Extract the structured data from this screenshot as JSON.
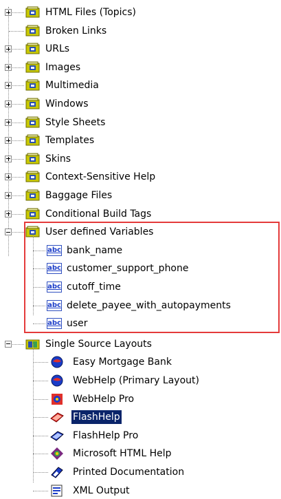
{
  "tree": {
    "folders": [
      {
        "label": "HTML Files (Topics)",
        "toggle": "plus",
        "icon": "folder-globe-icon",
        "color": "#c8c800"
      },
      {
        "label": "Broken Links",
        "toggle": "none",
        "icon": "folder-broken-links-icon",
        "color": "#c8c800"
      },
      {
        "label": "URLs",
        "toggle": "plus",
        "icon": "folder-url-icon",
        "color": "#c8c800"
      },
      {
        "label": "Images",
        "toggle": "plus",
        "icon": "folder-images-icon",
        "color": "#c8c800"
      },
      {
        "label": "Multimedia",
        "toggle": "plus",
        "icon": "folder-multimedia-icon",
        "color": "#c8c800"
      },
      {
        "label": "Windows",
        "toggle": "plus",
        "icon": "folder-windows-icon",
        "color": "#c8c800"
      },
      {
        "label": "Style Sheets",
        "toggle": "plus",
        "icon": "folder-stylesheets-icon",
        "color": "#c8c800"
      },
      {
        "label": "Templates",
        "toggle": "plus",
        "icon": "folder-templates-icon",
        "color": "#c8c800"
      },
      {
        "label": "Skins",
        "toggle": "plus",
        "icon": "folder-skins-icon",
        "color": "#c8c800"
      },
      {
        "label": "Context-Sensitive Help",
        "toggle": "plus",
        "icon": "folder-context-help-icon",
        "color": "#c8c800"
      },
      {
        "label": "Baggage Files",
        "toggle": "plus",
        "icon": "folder-baggage-icon",
        "color": "#c8c800"
      },
      {
        "label": "Conditional Build Tags",
        "toggle": "plus",
        "icon": "folder-build-tags-icon",
        "color": "#c8c800"
      },
      {
        "label": "User defined Variables",
        "toggle": "minus",
        "icon": "folder-variables-icon",
        "color": "#c8c800"
      }
    ],
    "variables": [
      {
        "label": "bank_name",
        "icon_text": "abc"
      },
      {
        "label": "customer_support_phone",
        "icon_text": "abc"
      },
      {
        "label": "cutoff_time",
        "icon_text": "abc"
      },
      {
        "label": "delete_payee_with_autopayments",
        "icon_text": "abc"
      },
      {
        "label": "user",
        "icon_text": "abc"
      }
    ],
    "layouts_folder": {
      "label": "Single Source Layouts",
      "toggle": "minus"
    },
    "layouts": [
      {
        "label": "Easy Mortgage Bank",
        "icon": "globe-layout-icon",
        "selected": false
      },
      {
        "label": "WebHelp (Primary Layout)",
        "icon": "globe-layout-icon",
        "selected": false
      },
      {
        "label": "WebHelp Pro",
        "icon": "webhelp-pro-icon",
        "selected": false
      },
      {
        "label": "FlashHelp",
        "icon": "flashhelp-icon",
        "selected": true
      },
      {
        "label": "FlashHelp Pro",
        "icon": "flashhelp-pro-icon",
        "selected": false
      },
      {
        "label": "Microsoft HTML Help",
        "icon": "html-help-icon",
        "selected": false
      },
      {
        "label": "Printed Documentation",
        "icon": "printed-doc-icon",
        "selected": false
      },
      {
        "label": "XML Output",
        "icon": "xml-output-icon",
        "selected": false
      }
    ],
    "highlight_color": "#e43a3a",
    "selection_color": "#0a246a"
  }
}
